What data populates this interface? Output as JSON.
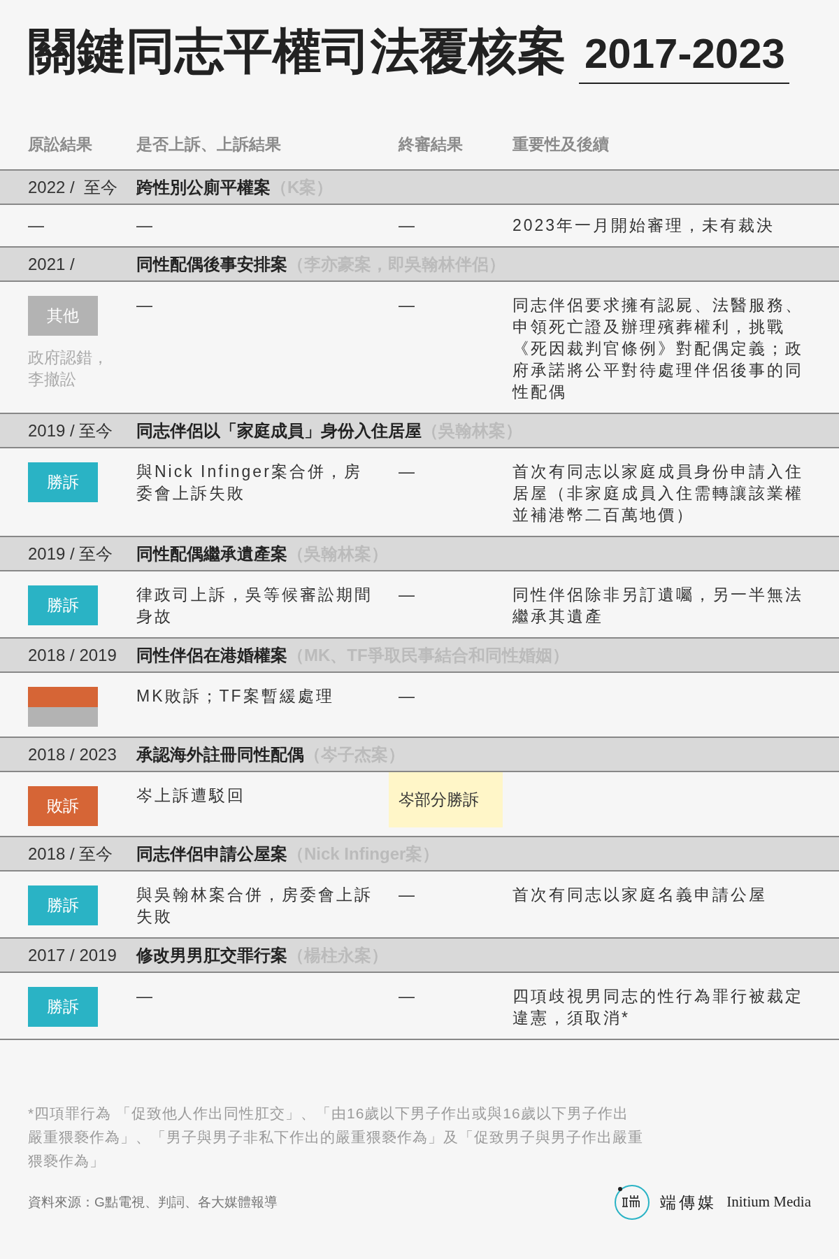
{
  "title": "關鍵同志平權司法覆核案",
  "title_years": "2017-2023",
  "columns": [
    "原訟結果",
    "是否上訴、上訴結果",
    "終審結果",
    "重要性及後續"
  ],
  "cases": [
    {
      "years": "2022 /  至今",
      "name": "跨性別公廁平權案",
      "alias": "（K案）",
      "first_instance": {
        "kind": "text",
        "text": "—"
      },
      "appeal": "—",
      "final": {
        "text": "—",
        "highlighted": false
      },
      "significance": "2023年一月開始審理，未有裁決"
    },
    {
      "years": "2021 /",
      "name": "同性配偶後事安排案",
      "alias": "（李亦豪案，即吳翰林伴侶）",
      "first_instance": {
        "kind": "badge",
        "text": "其他",
        "color": "#b3b3b3"
      },
      "first_instance_note": "政府認錯，李撤訟",
      "appeal": "—",
      "final": {
        "text": "—",
        "highlighted": false
      },
      "significance": "同志伴侶要求擁有認屍、法醫服務、申領死亡證及辦理殯葬權利，挑戰《死因裁判官條例》對配偶定義；政府承諾將公平對待處理伴侶後事的同性配偶"
    },
    {
      "years": "2019 / 至今",
      "name": "同志伴侶以「家庭成員」身份入住居屋",
      "alias": "（吳翰林案）",
      "first_instance": {
        "kind": "badge",
        "text": "勝訴",
        "color": "#2ab3c5"
      },
      "appeal": "與Nick Infinger案合併，房委會上訴失敗",
      "final": {
        "text": "—",
        "highlighted": false
      },
      "significance": "首次有同志以家庭成員身份申請入住居屋（非家庭成員入住需轉讓該業權並補港幣二百萬地價）"
    },
    {
      "years": "2019 / 至今",
      "name": "同性配偶繼承遺產案",
      "alias": "（吳翰林案）",
      "first_instance": {
        "kind": "badge",
        "text": "勝訴",
        "color": "#2ab3c5"
      },
      "appeal": "律政司上訴，吳等候審訟期間身故",
      "final": {
        "text": "—",
        "highlighted": false
      },
      "significance": "同性伴侶除非另訂遺囑，另一半無法繼承其遺產"
    },
    {
      "years": "2018 / 2019",
      "name": "同性伴侶在港婚權案",
      "alias": "（MK、TF爭取民事結合和同性婚姻）",
      "first_instance": {
        "kind": "split",
        "parts": [
          {
            "color": "#d66536"
          },
          {
            "color": "#b3b3b3"
          }
        ]
      },
      "appeal": "MK敗訴；TF案暫緩處理",
      "final": {
        "text": "—",
        "highlighted": false
      }
    },
    {
      "years": "2018 / 2023",
      "name": "承認海外註冊同性配偶",
      "alias": "（岑子杰案）",
      "first_instance": {
        "kind": "badge",
        "text": "敗訴",
        "color": "#d66536"
      },
      "appeal": "岑上訴遭駁回",
      "final": {
        "text": "岑部分勝訴",
        "highlighted": true
      }
    },
    {
      "years": "2018 / 至今",
      "name": "同志伴侶申請公屋案",
      "alias": "（Nick Infinger案）",
      "first_instance": {
        "kind": "badge",
        "text": "勝訴",
        "color": "#2ab3c5"
      },
      "appeal": "與吳翰林案合併，房委會上訴失敗",
      "final": {
        "text": "—",
        "highlighted": false
      },
      "significance": "首次有同志以家庭名義申請公屋"
    },
    {
      "years": "2017 / 2019",
      "name": "修改男男肛交罪行案",
      "alias": "（楊柱永案）",
      "first_instance": {
        "kind": "badge",
        "text": "勝訴",
        "color": "#2ab3c5"
      },
      "appeal": "—",
      "final": {
        "text": "—",
        "highlighted": false
      },
      "significance": "四項歧視男同志的性行為罪行被裁定違憲，須取消*"
    }
  ],
  "footnote": "*四項罪行為 「促致他人作出同性肛交」、「由16歲以下男子作出或與16歲以下男子作出嚴重猥褻作為」、「男子與男子非私下作出的嚴重猥褻作為」及「促致男子與男子作出嚴重猥褻作為」",
  "source": "資料來源：G點電視、判詞、各大媒體報導",
  "brand": {
    "name_zh": "端傳媒",
    "name_en": "Initium Media"
  }
}
